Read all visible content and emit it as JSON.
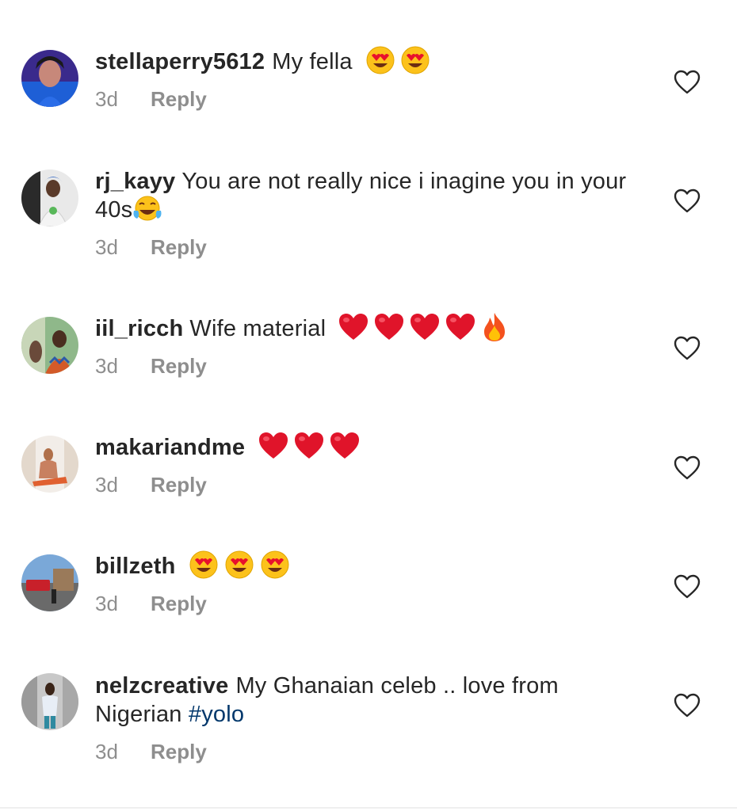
{
  "comments": [
    {
      "username": "stellaperry5612",
      "text": "My fella",
      "emoji": [
        "heart-eyes",
        "heart-eyes"
      ],
      "time": "3d",
      "reply_label": "Reply"
    },
    {
      "username": "rj_kayy",
      "text": "You are not really nice i inagine you in your 40s",
      "emoji": [
        "tears-of-joy"
      ],
      "time": "3d",
      "reply_label": "Reply"
    },
    {
      "username": "iil_ricch",
      "text": "Wife material",
      "emoji": [
        "red-heart",
        "red-heart",
        "red-heart",
        "red-heart",
        "fire"
      ],
      "time": "3d",
      "reply_label": "Reply"
    },
    {
      "username": "makariandme",
      "text": "",
      "emoji": [
        "red-heart",
        "red-heart",
        "red-heart"
      ],
      "time": "3d",
      "reply_label": "Reply"
    },
    {
      "username": "billzeth",
      "text": "",
      "emoji": [
        "heart-eyes",
        "heart-eyes",
        "heart-eyes"
      ],
      "time": "3d",
      "reply_label": "Reply"
    },
    {
      "username": "nelzcreative",
      "text": "My Ghanaian celeb .. love from Nigerian",
      "hashtag": "#yolo",
      "time": "3d",
      "reply_label": "Reply"
    }
  ],
  "colors": {
    "text": "#262626",
    "secondary": "#8e8e8e",
    "hashtag": "#00376b"
  }
}
